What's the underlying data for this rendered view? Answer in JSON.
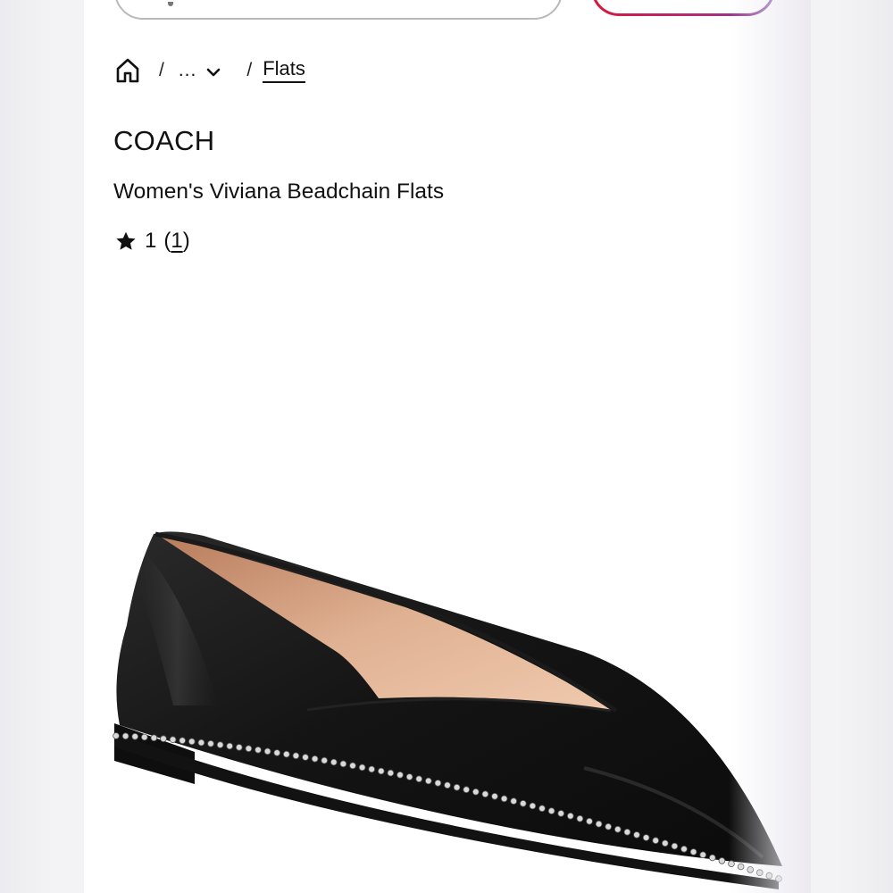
{
  "breadcrumb": {
    "separator": "/",
    "collapsed": "...",
    "current": "Flats"
  },
  "product": {
    "brand": "COACH",
    "name": "Women's Viviana Beadchain Flats",
    "rating": "1",
    "review_open": "(",
    "review_count": "1",
    "review_close": ")"
  },
  "colors": {
    "signin_gradient": [
      "#d6183c",
      "#7b3fa4"
    ],
    "text": "#111111"
  },
  "icons": [
    "home-icon",
    "chevron-down-icon",
    "star-icon"
  ]
}
